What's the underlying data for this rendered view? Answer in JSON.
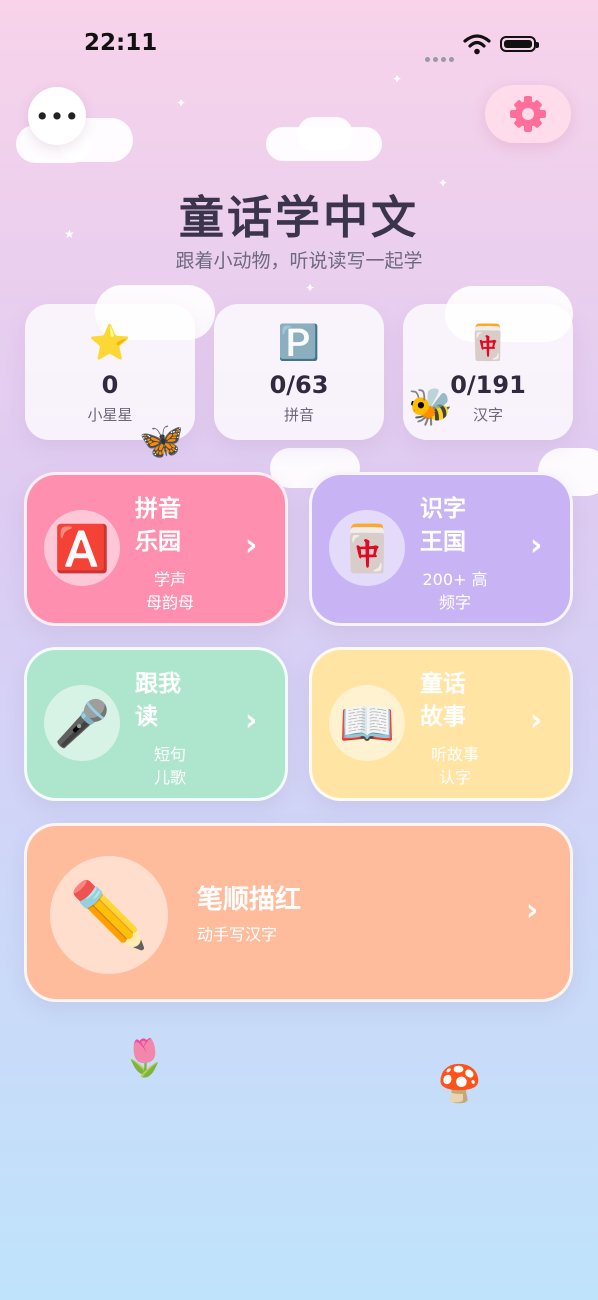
{
  "status_bar": {
    "time": "22:11"
  },
  "header": {
    "title": "童话学中文",
    "subtitle": "跟着小动物，听说读写一起学",
    "menu_icon": "more-horiz-icon",
    "settings_icon": "gear-icon"
  },
  "stats": [
    {
      "icon": "star-icon",
      "glyph": "⭐",
      "value": "0",
      "label": "小星星"
    },
    {
      "icon": "parking-p-icon",
      "glyph": "🅿️",
      "value": "0/63",
      "label": "拼音"
    },
    {
      "icon": "mahjong-tile-icon",
      "glyph": "🀄",
      "value": "0/191",
      "label": "汉字"
    }
  ],
  "cards": [
    {
      "name": "拼音乐园",
      "name_lines": [
        "拼音",
        "乐园"
      ],
      "desc_lines": [
        "学声",
        "母韵母"
      ],
      "glyph": "🅰️",
      "icon": "letter-a-icon",
      "color": "#ff8fae"
    },
    {
      "name": "识字王国",
      "name_lines": [
        "识字",
        "王国"
      ],
      "desc_lines": [
        "200+ 高",
        "频字"
      ],
      "glyph": "🀄",
      "icon": "mahjong-tile-icon",
      "color": "#c8b4f5"
    },
    {
      "name": "跟我读",
      "name_lines": [
        "跟我",
        "读"
      ],
      "desc_lines": [
        "短句",
        "儿歌"
      ],
      "glyph": "🎤",
      "icon": "microphone-icon",
      "color": "#aee6cd"
    },
    {
      "name": "童话故事",
      "name_lines": [
        "童话",
        "故事"
      ],
      "desc_lines": [
        "听故事",
        "认字"
      ],
      "glyph": "📖",
      "icon": "book-icon",
      "color": "#ffe4a3"
    }
  ],
  "big_card": {
    "name": "笔顺描红",
    "desc": "动手写汉字",
    "glyph": "✏️",
    "icon": "pencil-icon",
    "color": "#ffbc9c"
  },
  "decorations": [
    {
      "icon": "butterfly-icon",
      "glyph": "🦋"
    },
    {
      "icon": "bee-icon",
      "glyph": "🐝"
    },
    {
      "icon": "tulip-icon",
      "glyph": "🌷"
    },
    {
      "icon": "mushroom-icon",
      "glyph": "🍄"
    }
  ]
}
